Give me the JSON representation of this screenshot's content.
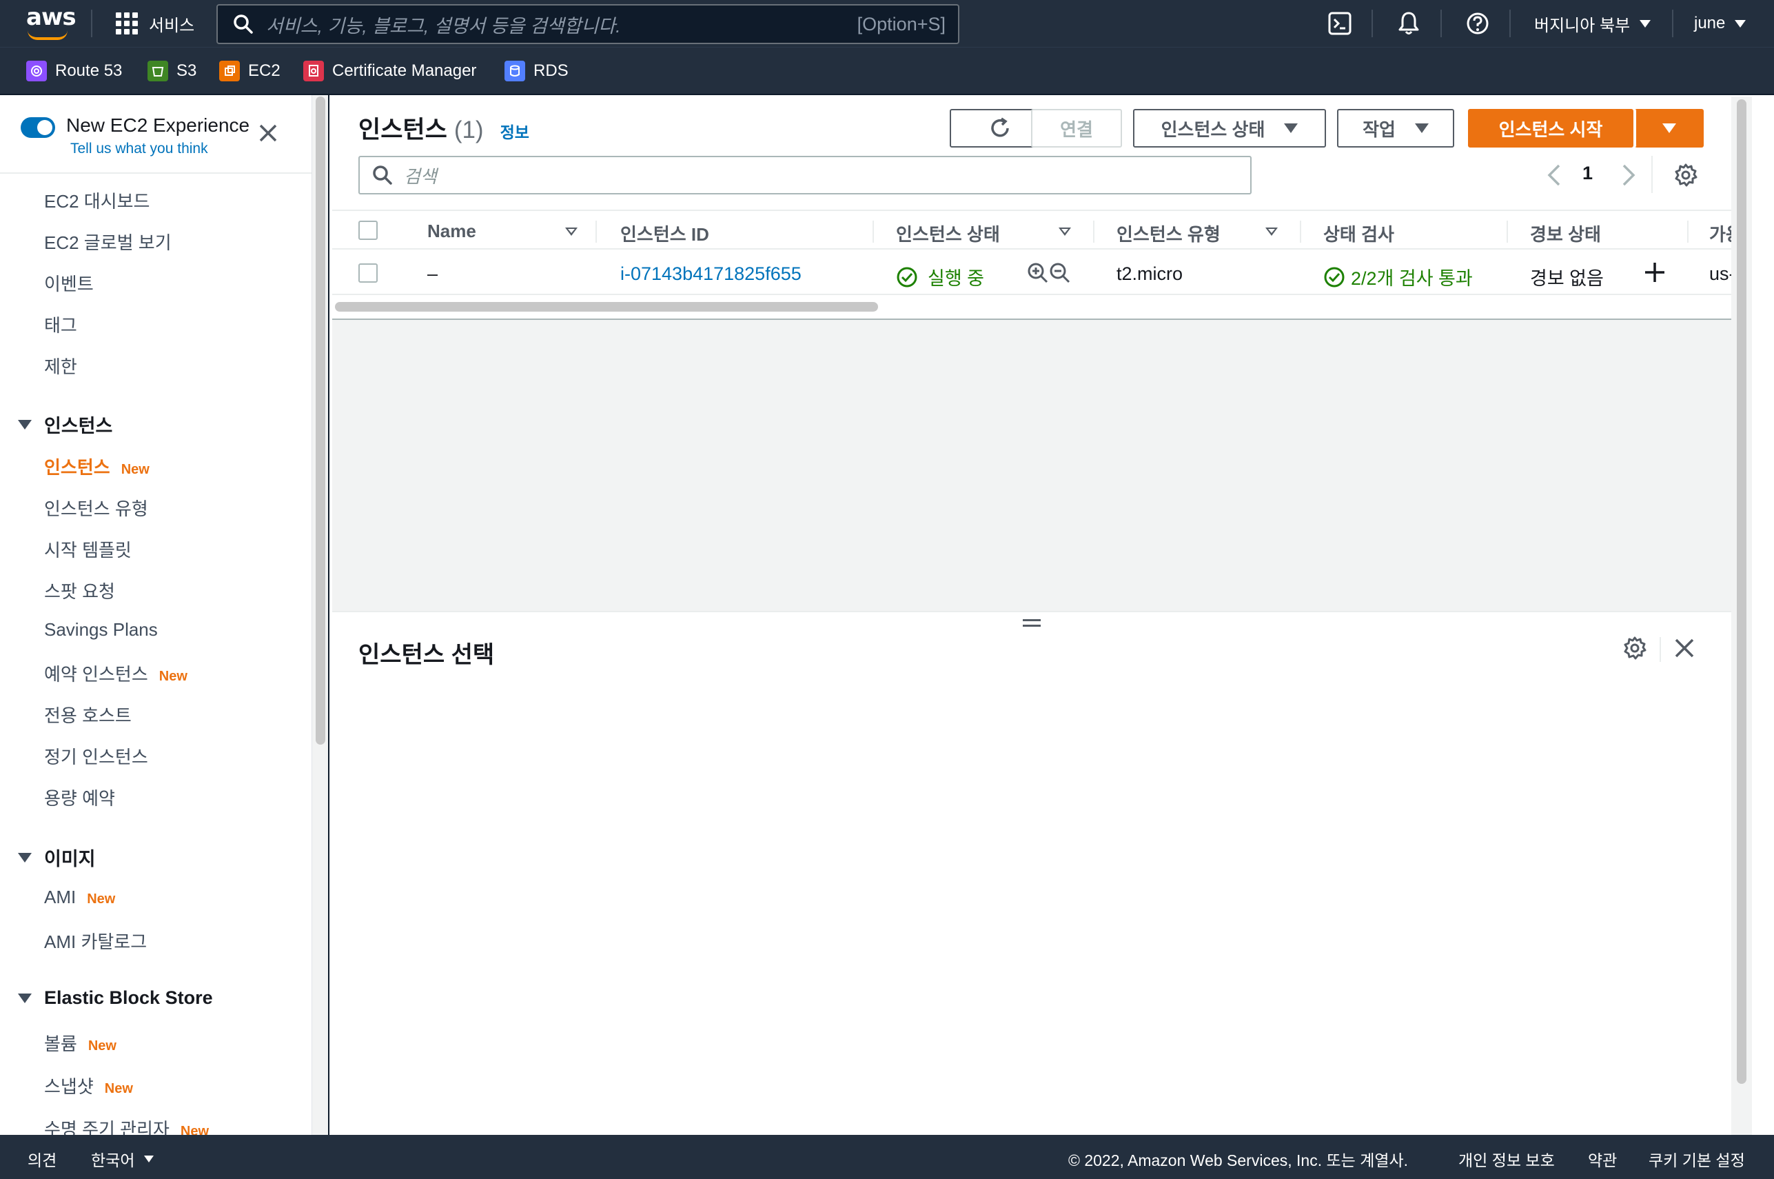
{
  "topnav": {
    "logo_text": "aws",
    "services_label": "서비스",
    "search_placeholder": "서비스, 기능, 블로그, 설명서 등을 검색합니다.",
    "search_shortcut": "[Option+S]",
    "region": "버지니아 북부",
    "user": "june"
  },
  "favorites": [
    {
      "label": "Route 53",
      "color": "#8c4fff"
    },
    {
      "label": "S3",
      "color": "#3f8624"
    },
    {
      "label": "EC2",
      "color": "#ed7100"
    },
    {
      "label": "Certificate Manager",
      "color": "#dd344c"
    },
    {
      "label": "RDS",
      "color": "#527fff"
    }
  ],
  "sidebar": {
    "experience_title": "New EC2 Experience",
    "experience_link": "Tell us what you think",
    "items_top": [
      "EC2 대시보드",
      "EC2 글로벌 보기",
      "이벤트",
      "태그",
      "제한"
    ],
    "section_instances": "인스턴스",
    "instances_items": [
      {
        "label": "인스턴스",
        "badge": "New"
      },
      {
        "label": "인스턴스 유형",
        "badge": ""
      },
      {
        "label": "시작 템플릿",
        "badge": ""
      },
      {
        "label": "스팟 요청",
        "badge": ""
      },
      {
        "label": "Savings Plans",
        "badge": ""
      },
      {
        "label": "예약 인스턴스",
        "badge": "New"
      },
      {
        "label": "전용 호스트",
        "badge": ""
      },
      {
        "label": "정기 인스턴스",
        "badge": ""
      },
      {
        "label": "용량 예약",
        "badge": ""
      }
    ],
    "section_images": "이미지",
    "images_items": [
      {
        "label": "AMI",
        "badge": "New"
      },
      {
        "label": "AMI 카탈로그",
        "badge": ""
      }
    ],
    "section_ebs": "Elastic Block Store",
    "ebs_items": [
      {
        "label": "볼륨",
        "badge": "New"
      },
      {
        "label": "스냅샷",
        "badge": "New"
      },
      {
        "label": "수명 주기 관리자",
        "badge": "New"
      }
    ]
  },
  "main": {
    "title": "인스턴스",
    "count": "(1)",
    "info": "정보",
    "btn_connect": "연결",
    "btn_state": "인스턴스 상태",
    "btn_actions": "작업",
    "btn_launch": "인스턴스 시작",
    "filter_placeholder": "검색",
    "page": "1",
    "columns": [
      "Name",
      "인스턴스 ID",
      "인스턴스 상태",
      "인스턴스 유형",
      "상태 검사",
      "경보 상태",
      "가용"
    ],
    "row": {
      "name": "–",
      "id": "i-07143b4171825f655",
      "state": "실행 중",
      "type": "t2.micro",
      "check": "2/2개 검사 통과",
      "alarm": "경보 없음",
      "az": "us-"
    },
    "split_title": "인스턴스 선택"
  },
  "footer": {
    "feedback": "의견",
    "language": "한국어",
    "copyright": "© 2022, Amazon Web Services, Inc. 또는 계열사.",
    "privacy": "개인 정보 보호",
    "terms": "약관",
    "cookies": "쿠키 기본 설정"
  }
}
